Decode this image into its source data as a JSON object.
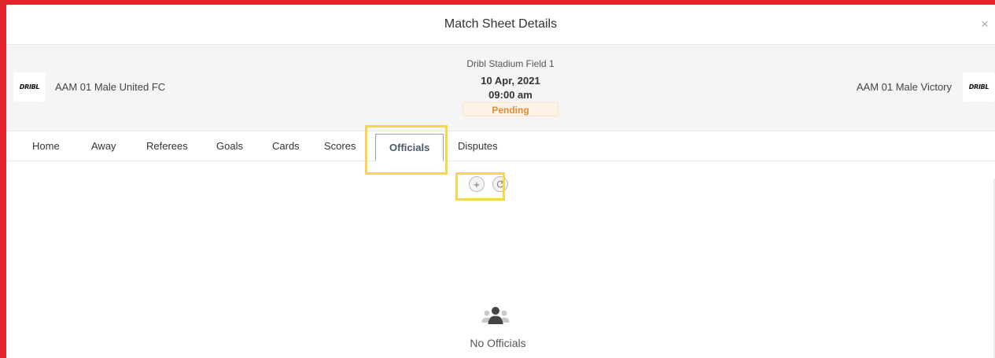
{
  "modal": {
    "title": "Match Sheet Details",
    "close_symbol": "×"
  },
  "match": {
    "home_team": {
      "logo_text": "DRIBL",
      "name": "AAM 01 Male United FC"
    },
    "away_team": {
      "logo_text": "DRIBL",
      "name": "AAM 01 Male Victory"
    },
    "venue": "Dribl Stadium Field 1",
    "date": "10 Apr, 2021",
    "time": "09:00 am",
    "status": "Pending"
  },
  "tabs": [
    {
      "label": "Home"
    },
    {
      "label": "Away"
    },
    {
      "label": "Referees"
    },
    {
      "label": "Goals"
    },
    {
      "label": "Cards"
    },
    {
      "label": "Scores"
    },
    {
      "label": "Officials",
      "active": true
    },
    {
      "label": "Disputes"
    }
  ],
  "actions": {
    "add_symbol": "+",
    "refresh_icon": "refresh-icon"
  },
  "empty_state": {
    "icon": "users-icon",
    "text": "No Officials"
  },
  "colors": {
    "frame": "#e0262b",
    "highlight": "#f6d64a",
    "pending_text": "#e4892f",
    "pending_bg": "#fdf3e6"
  }
}
